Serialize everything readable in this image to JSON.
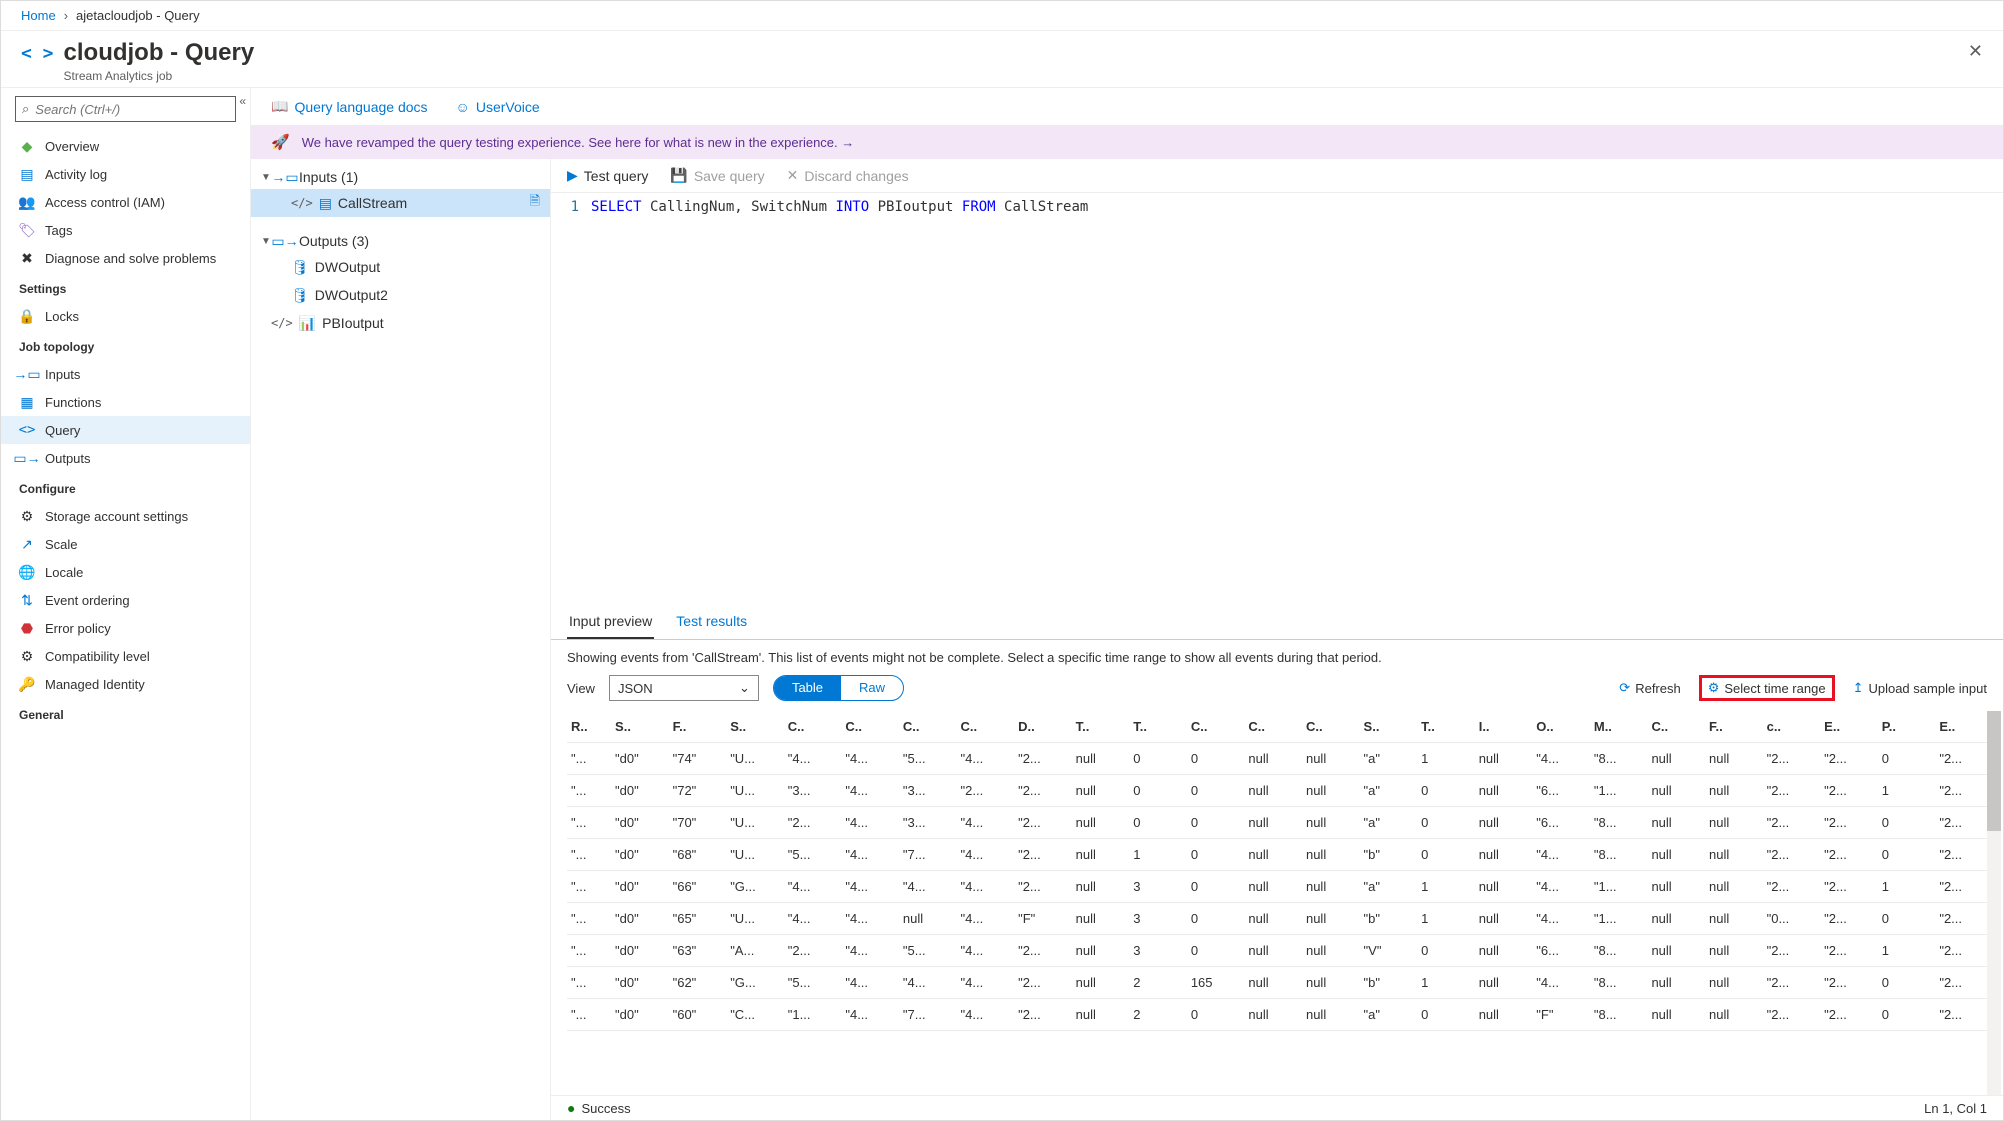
{
  "breadcrumb": {
    "home": "Home",
    "current": "ajetacloudjob - Query"
  },
  "header": {
    "title": "cloudjob - Query",
    "subtitle": "Stream Analytics job"
  },
  "search": {
    "placeholder": "Search (Ctrl+/)"
  },
  "nav": {
    "main": [
      {
        "label": "Overview"
      },
      {
        "label": "Activity log"
      },
      {
        "label": "Access control (IAM)"
      },
      {
        "label": "Tags"
      },
      {
        "label": "Diagnose and solve problems"
      }
    ],
    "settings_label": "Settings",
    "settings": [
      {
        "label": "Locks"
      }
    ],
    "topology_label": "Job topology",
    "topology": [
      {
        "label": "Inputs"
      },
      {
        "label": "Functions"
      },
      {
        "label": "Query",
        "active": true
      },
      {
        "label": "Outputs"
      }
    ],
    "configure_label": "Configure",
    "configure": [
      {
        "label": "Storage account settings"
      },
      {
        "label": "Scale"
      },
      {
        "label": "Locale"
      },
      {
        "label": "Event ordering"
      },
      {
        "label": "Error policy"
      },
      {
        "label": "Compatibility level"
      },
      {
        "label": "Managed Identity"
      }
    ],
    "general_label": "General"
  },
  "toolbar": {
    "docs": "Query language docs",
    "uservoice": "UserVoice"
  },
  "banner": {
    "text": "We have revamped the query testing experience. See here for what is new in the experience. →"
  },
  "tree": {
    "inputs_label": "Inputs (1)",
    "inputs": [
      {
        "label": "CallStream",
        "selected": true
      }
    ],
    "outputs_label": "Outputs (3)",
    "outputs": [
      {
        "label": "DWOutput"
      },
      {
        "label": "DWOutput2"
      },
      {
        "label": "PBIoutput",
        "code": true
      }
    ]
  },
  "editor_actions": {
    "test": "Test query",
    "save": "Save query",
    "discard": "Discard changes"
  },
  "code": {
    "line": "1",
    "tokens": [
      "SELECT",
      " CallingNum, SwitchNum ",
      "INTO",
      " PBIoutput ",
      "FROM",
      " CallStream"
    ]
  },
  "tabs": {
    "preview": "Input preview",
    "results": "Test results"
  },
  "preview": {
    "msg": "Showing events from 'CallStream'. This list of events might not be complete. Select a specific time range to show all events during that period.",
    "view_label": "View",
    "view_value": "JSON",
    "toggle_table": "Table",
    "toggle_raw": "Raw",
    "refresh": "Refresh",
    "select_range": "Select time range",
    "upload": "Upload sample input"
  },
  "grid": {
    "cols": [
      "R..",
      "S..",
      "F..",
      "S..",
      "C..",
      "C..",
      "C..",
      "C..",
      "D..",
      "T..",
      "T..",
      "C..",
      "C..",
      "C..",
      "S..",
      "T..",
      "I..",
      "O..",
      "M..",
      "C..",
      "F..",
      "c..",
      "E..",
      "P..",
      "E.."
    ],
    "rows": [
      [
        "\"...",
        "\"d0\"",
        "\"74\"",
        "\"U...",
        "\"4...",
        "\"4...",
        "\"5...",
        "\"4...",
        "\"2...",
        "null",
        "0",
        "0",
        "null",
        "null",
        "\"a\"",
        "1",
        "null",
        "\"4...",
        "\"8...",
        "null",
        "null",
        "\"2...",
        "\"2...",
        "0",
        "\"2..."
      ],
      [
        "\"...",
        "\"d0\"",
        "\"72\"",
        "\"U...",
        "\"3...",
        "\"4...",
        "\"3...",
        "\"2...",
        "\"2...",
        "null",
        "0",
        "0",
        "null",
        "null",
        "\"a\"",
        "0",
        "null",
        "\"6...",
        "\"1...",
        "null",
        "null",
        "\"2...",
        "\"2...",
        "1",
        "\"2..."
      ],
      [
        "\"...",
        "\"d0\"",
        "\"70\"",
        "\"U...",
        "\"2...",
        "\"4...",
        "\"3...",
        "\"4...",
        "\"2...",
        "null",
        "0",
        "0",
        "null",
        "null",
        "\"a\"",
        "0",
        "null",
        "\"6...",
        "\"8...",
        "null",
        "null",
        "\"2...",
        "\"2...",
        "0",
        "\"2..."
      ],
      [
        "\"...",
        "\"d0\"",
        "\"68\"",
        "\"U...",
        "\"5...",
        "\"4...",
        "\"7...",
        "\"4...",
        "\"2...",
        "null",
        "1",
        "0",
        "null",
        "null",
        "\"b\"",
        "0",
        "null",
        "\"4...",
        "\"8...",
        "null",
        "null",
        "\"2...",
        "\"2...",
        "0",
        "\"2..."
      ],
      [
        "\"...",
        "\"d0\"",
        "\"66\"",
        "\"G...",
        "\"4...",
        "\"4...",
        "\"4...",
        "\"4...",
        "\"2...",
        "null",
        "3",
        "0",
        "null",
        "null",
        "\"a\"",
        "1",
        "null",
        "\"4...",
        "\"1...",
        "null",
        "null",
        "\"2...",
        "\"2...",
        "1",
        "\"2..."
      ],
      [
        "\"...",
        "\"d0\"",
        "\"65\"",
        "\"U...",
        "\"4...",
        "\"4...",
        "null",
        "\"4...",
        "\"F\"",
        "null",
        "3",
        "0",
        "null",
        "null",
        "\"b\"",
        "1",
        "null",
        "\"4...",
        "\"1...",
        "null",
        "null",
        "\"0...",
        "\"2...",
        "0",
        "\"2..."
      ],
      [
        "\"...",
        "\"d0\"",
        "\"63\"",
        "\"A...",
        "\"2...",
        "\"4...",
        "\"5...",
        "\"4...",
        "\"2...",
        "null",
        "3",
        "0",
        "null",
        "null",
        "\"V\"",
        "0",
        "null",
        "\"6...",
        "\"8...",
        "null",
        "null",
        "\"2...",
        "\"2...",
        "1",
        "\"2..."
      ],
      [
        "\"...",
        "\"d0\"",
        "\"62\"",
        "\"G...",
        "\"5...",
        "\"4...",
        "\"4...",
        "\"4...",
        "\"2...",
        "null",
        "2",
        "165",
        "null",
        "null",
        "\"b\"",
        "1",
        "null",
        "\"4...",
        "\"8...",
        "null",
        "null",
        "\"2...",
        "\"2...",
        "0",
        "\"2..."
      ],
      [
        "\"...",
        "\"d0\"",
        "\"60\"",
        "\"C...",
        "\"1...",
        "\"4...",
        "\"7...",
        "\"4...",
        "\"2...",
        "null",
        "2",
        "0",
        "null",
        "null",
        "\"a\"",
        "0",
        "null",
        "\"F\"",
        "\"8...",
        "null",
        "null",
        "\"2...",
        "\"2...",
        "0",
        "\"2..."
      ]
    ]
  },
  "status": {
    "ok": "Success",
    "pos": "Ln 1, Col 1"
  }
}
